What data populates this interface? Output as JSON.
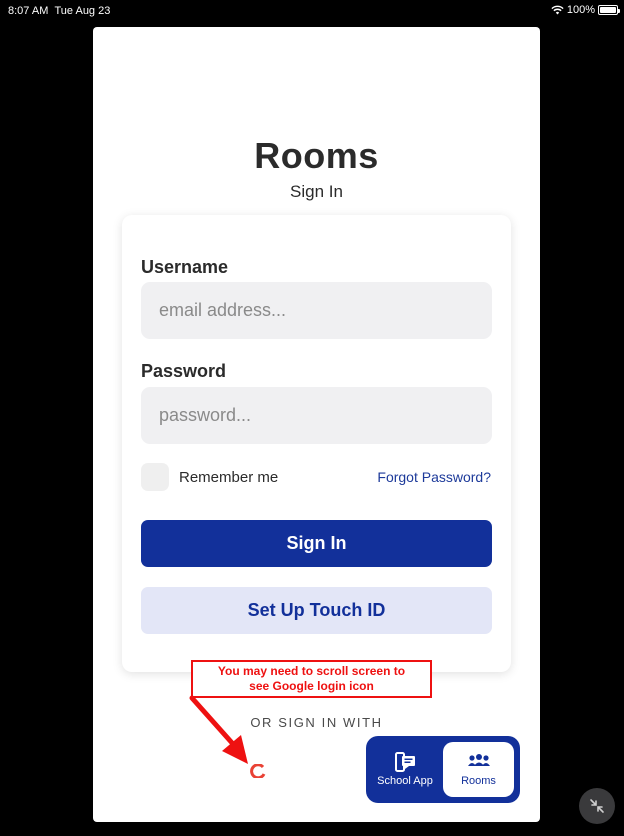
{
  "status_bar": {
    "time": "8:07 AM",
    "date": "Tue Aug 23",
    "battery": "100%",
    "battery_level": 1.0
  },
  "header": {
    "title": "Rooms",
    "subtitle": "Sign In"
  },
  "login_form": {
    "username_label": "Username",
    "username_placeholder": "email address...",
    "username_value": "",
    "password_label": "Password",
    "password_placeholder": "password...",
    "password_value": "",
    "remember_label": "Remember me",
    "remember_checked": false,
    "forgot_link": "Forgot Password?",
    "sign_in_button": "Sign In",
    "touch_id_button": "Set Up Touch ID"
  },
  "alt_login": {
    "or_text": "OR SIGN IN WITH",
    "google_icon": "google-icon"
  },
  "annotation": {
    "line1": "You may need to scroll screen to",
    "line2": "see Google login icon",
    "color": "#e11111"
  },
  "app_switcher": {
    "items": [
      {
        "label": "School App",
        "icon": "school-app-icon",
        "active": false
      },
      {
        "label": "Rooms",
        "icon": "rooms-icon",
        "active": true
      }
    ]
  },
  "colors": {
    "primary": "#12309a",
    "secondary_bg": "#e3e6f7",
    "input_bg": "#f0f0f2"
  }
}
